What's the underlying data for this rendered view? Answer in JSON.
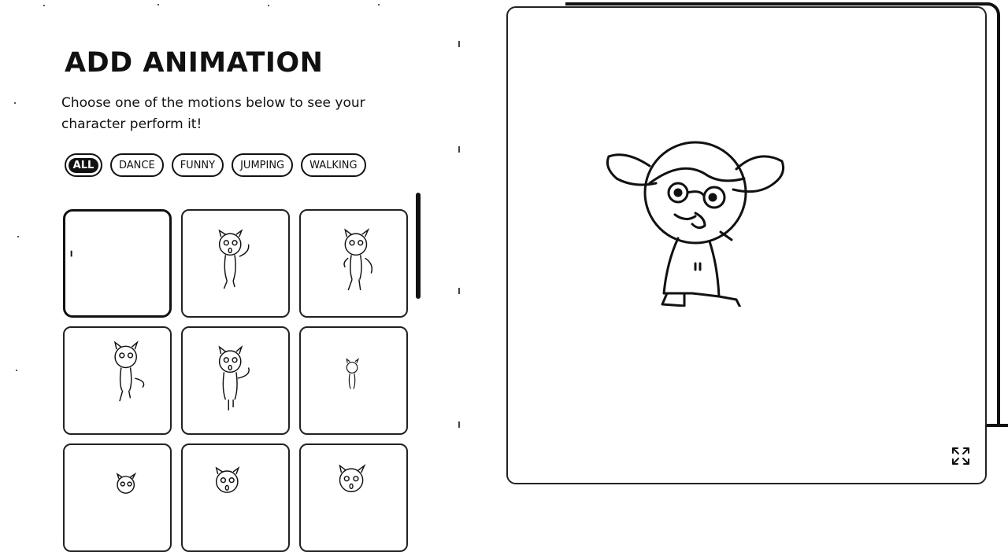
{
  "panel": {
    "title": "ADD ANIMATION",
    "subtitle": "Choose one of the motions below to see your character perform it!"
  },
  "filters": [
    {
      "label": "ALL",
      "active": true
    },
    {
      "label": "DANCE",
      "active": false
    },
    {
      "label": "FUNNY",
      "active": false
    },
    {
      "label": "JUMPING",
      "active": false
    },
    {
      "label": "WALKING",
      "active": false
    }
  ],
  "animation_cards": {
    "visible_count": 9,
    "selected_index": 0
  },
  "preview": {
    "expand_icon": "expand-icon"
  },
  "colors": {
    "ink": "#111111",
    "background": "#ffffff"
  }
}
